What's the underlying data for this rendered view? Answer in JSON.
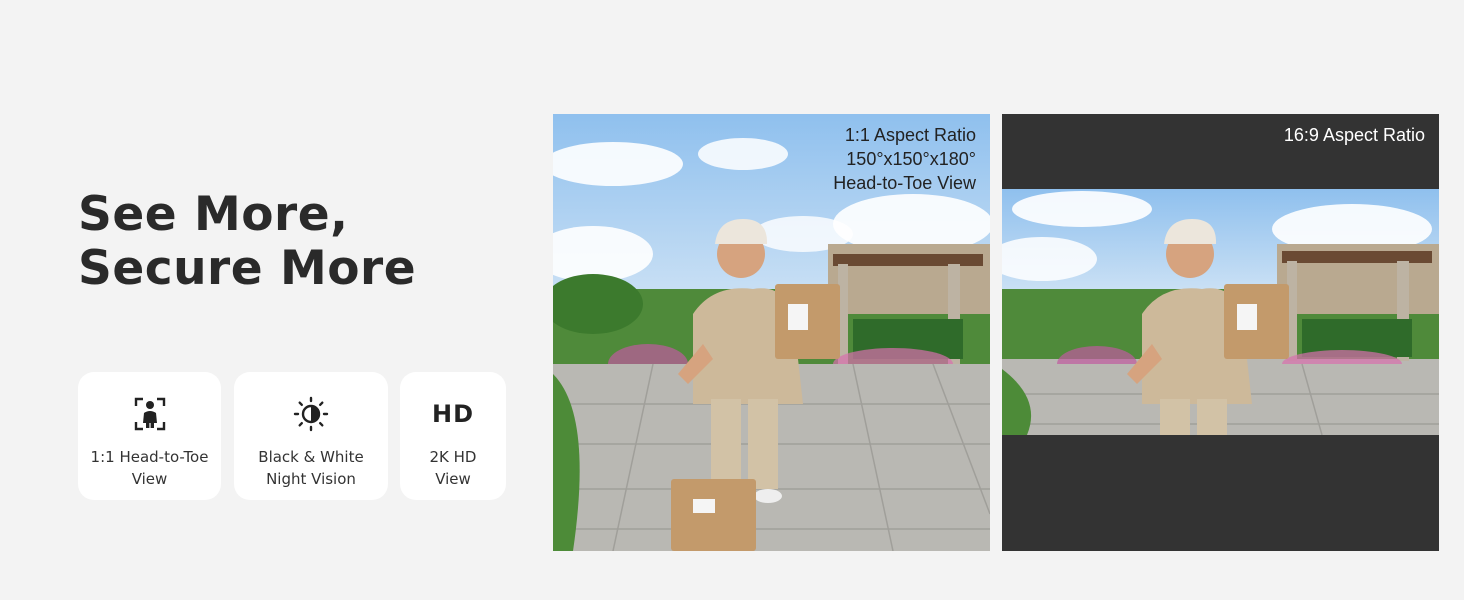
{
  "headline": {
    "line1": "See More,",
    "line2": "Secure More"
  },
  "features": [
    {
      "icon": "person-frame-icon",
      "line1": "1:1 Head-to-Toe",
      "line2": "View"
    },
    {
      "icon": "sun-moon-icon",
      "line1": "Black & White",
      "line2": "Night Vision"
    },
    {
      "icon": "hd-icon",
      "icon_text": "HD",
      "line1": "2K HD",
      "line2": "View"
    }
  ],
  "panels": {
    "square": {
      "line1": "1:1 Aspect Ratio",
      "line2": "150°x150°x180°",
      "line3": "Head-to-Toe View"
    },
    "wide": {
      "line1": "16:9 Aspect Ratio"
    }
  },
  "colors": {
    "background": "#f3f3f3",
    "card": "#ffffff",
    "letterbox": "#333333",
    "sky": "#9ec9ef"
  }
}
